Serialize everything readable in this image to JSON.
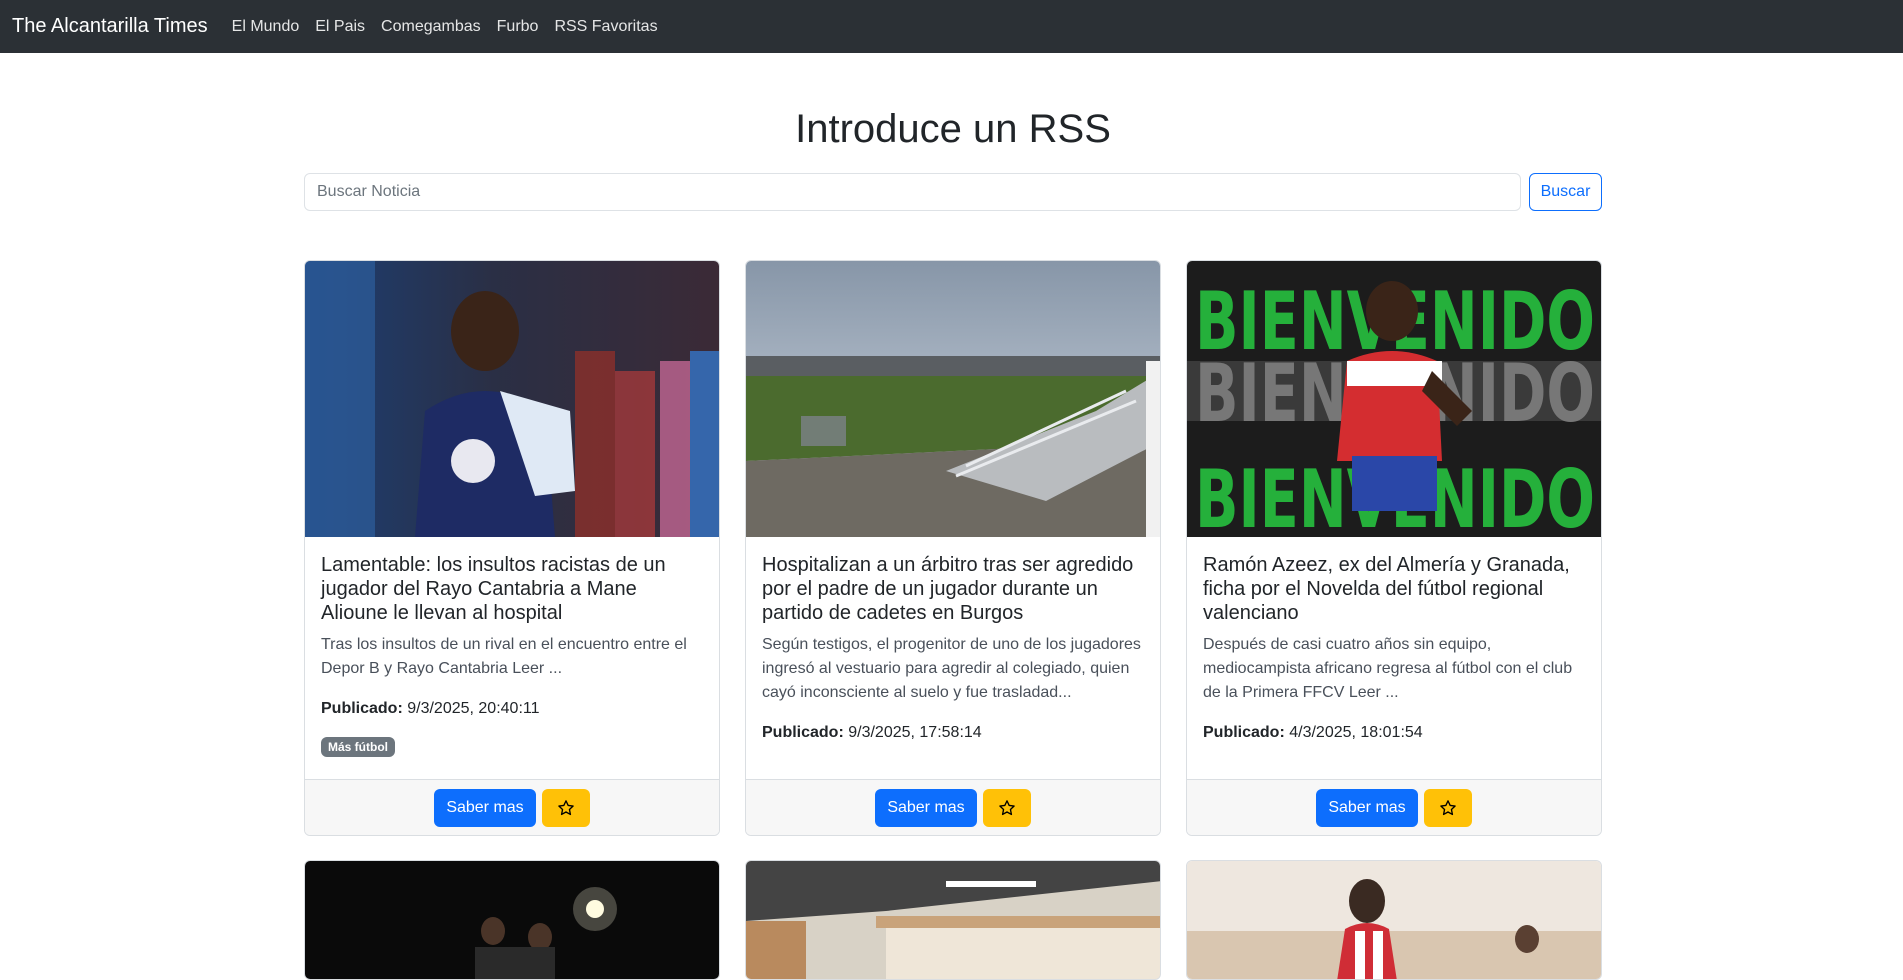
{
  "nav": {
    "brand": "The Alcantarilla Times",
    "links": [
      "El Mundo",
      "El Pais",
      "Comegambas",
      "Furbo",
      "RSS Favoritas"
    ]
  },
  "heading": "Introduce un RSS",
  "search": {
    "placeholder": "Buscar Noticia",
    "button_label": "Buscar"
  },
  "published_label": "Publicado:",
  "more_label": "Saber mas",
  "cards": [
    {
      "title": "Lamentable: los insultos racistas de un jugador del Rayo Cantabria a Mane Alioune le llevan al hospital",
      "text": "Tras los insultos de un rival en el encuentro entre el Depor B y Rayo Cantabria  Leer ...",
      "date": "9/3/2025, 20:40:11",
      "badge": "Más fútbol"
    },
    {
      "title": "Hospitalizan a un árbitro tras ser agredido por el padre de un jugador durante un partido de cadetes en Burgos",
      "text": "Según testigos, el progenitor de uno de los jugadores ingresó al vestuario para agredir al colegiado, quien cayó inconsciente al suelo y fue trasladad...",
      "date": "9/3/2025, 17:58:14"
    },
    {
      "title": "Ramón Azeez, ex del Almería y Granada, ficha por el Novelda del fútbol regional valenciano",
      "text": "Después de casi cuatro años sin equipo, mediocampista africano regresa al fútbol con el club de la Primera FFCV  Leer ...",
      "date": "4/3/2025, 18:01:54"
    }
  ],
  "image_overlay_texts": [
    "BIENVENIDO",
    "BIENVENIDO",
    "BIENVENIDO"
  ],
  "colors": {
    "navbar": "#2b3035",
    "primary": "#0d6efd",
    "warning": "#ffc107",
    "badge": "#6c757d"
  },
  "icons": {
    "favorite": "star-icon"
  }
}
